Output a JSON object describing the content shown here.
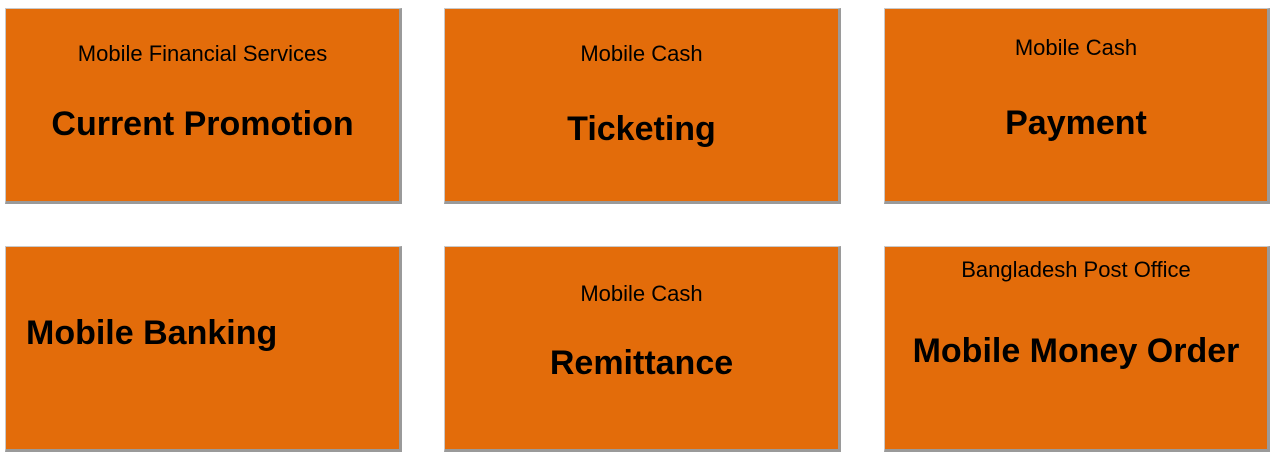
{
  "tiles": [
    {
      "subtitle": "Mobile Financial Services",
      "title": "Current Promotion"
    },
    {
      "subtitle": "Mobile Cash",
      "title": "Ticketing"
    },
    {
      "subtitle": "Mobile Cash",
      "title": "Payment"
    },
    {
      "subtitle": "",
      "title": "Mobile Banking"
    },
    {
      "subtitle": "Mobile Cash",
      "title": "Remittance"
    },
    {
      "subtitle": "Bangladesh Post Office",
      "title": "Mobile Money Order"
    }
  ],
  "colors": {
    "tile_background": "#e36c0a",
    "tile_text": "#000000",
    "tile_shadow": "#9a9a9a"
  }
}
